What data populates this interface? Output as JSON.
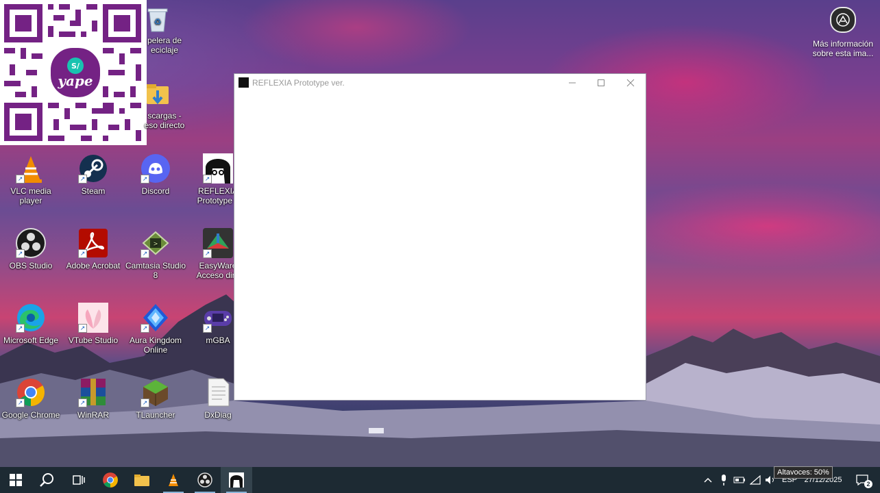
{
  "desktop": {
    "qr": {
      "brand": "yape",
      "coin": "S/"
    },
    "icons": [
      {
        "label": "Papelera de reciclaje",
        "line1": "pelera de",
        "line2": "eciclaje"
      },
      {
        "label": "Descargas - Acceso directo",
        "line1": "scargas -",
        "line2": "eso directo"
      },
      {
        "label": "VLC media player",
        "line1": "VLC media player",
        "line2": ""
      },
      {
        "label": "Steam",
        "line1": "Steam",
        "line2": ""
      },
      {
        "label": "Discord",
        "line1": "Discord",
        "line2": ""
      },
      {
        "label": "REFLEXIA Prototype ver.",
        "line1": "REFLEXIA",
        "line2": "Prototype v"
      },
      {
        "label": "OBS Studio",
        "line1": "OBS Studio",
        "line2": ""
      },
      {
        "label": "Adobe Acrobat",
        "line1": "Adobe Acrobat",
        "line2": ""
      },
      {
        "label": "Camtasia Studio 8",
        "line1": "Camtasia Studio",
        "line2": "8"
      },
      {
        "label": "EasyWare Acceso directo",
        "line1": "EasyWare",
        "line2": "Acceso dire"
      },
      {
        "label": "Microsoft Edge",
        "line1": "Microsoft Edge",
        "line2": ""
      },
      {
        "label": "VTube Studio",
        "line1": "VTube Studio",
        "line2": ""
      },
      {
        "label": "Aura Kingdom Online",
        "line1": "Aura Kingdom",
        "line2": "Online"
      },
      {
        "label": "mGBA",
        "line1": "mGBA",
        "line2": ""
      },
      {
        "label": "Google Chrome",
        "line1": "Google Chrome",
        "line2": ""
      },
      {
        "label": "WinRAR",
        "line1": "WinRAR",
        "line2": ""
      },
      {
        "label": "TLauncher",
        "line1": "TLauncher",
        "line2": ""
      },
      {
        "label": "DxDiag",
        "line1": "DxDiag",
        "line2": ""
      }
    ],
    "more_info": {
      "line1": "Más información",
      "line2": "sobre esta ima..."
    }
  },
  "window": {
    "title": "REFLEXIA Prototype ver.",
    "buttons": [
      "minimize",
      "maximize",
      "close"
    ]
  },
  "taskbar": {
    "pinned": [
      "start",
      "search",
      "task-view",
      "chrome",
      "file-explorer",
      "vlc",
      "obs",
      "reflexia"
    ],
    "tray": {
      "language": "ESP",
      "time": "",
      "date": "27/12/2025",
      "notification_count": "2",
      "volume_tooltip": "Altavoces: 50%"
    }
  },
  "colors": {
    "taskbar": "#1d2a33",
    "yape": "#742284",
    "accent": "#8ab4d8"
  }
}
